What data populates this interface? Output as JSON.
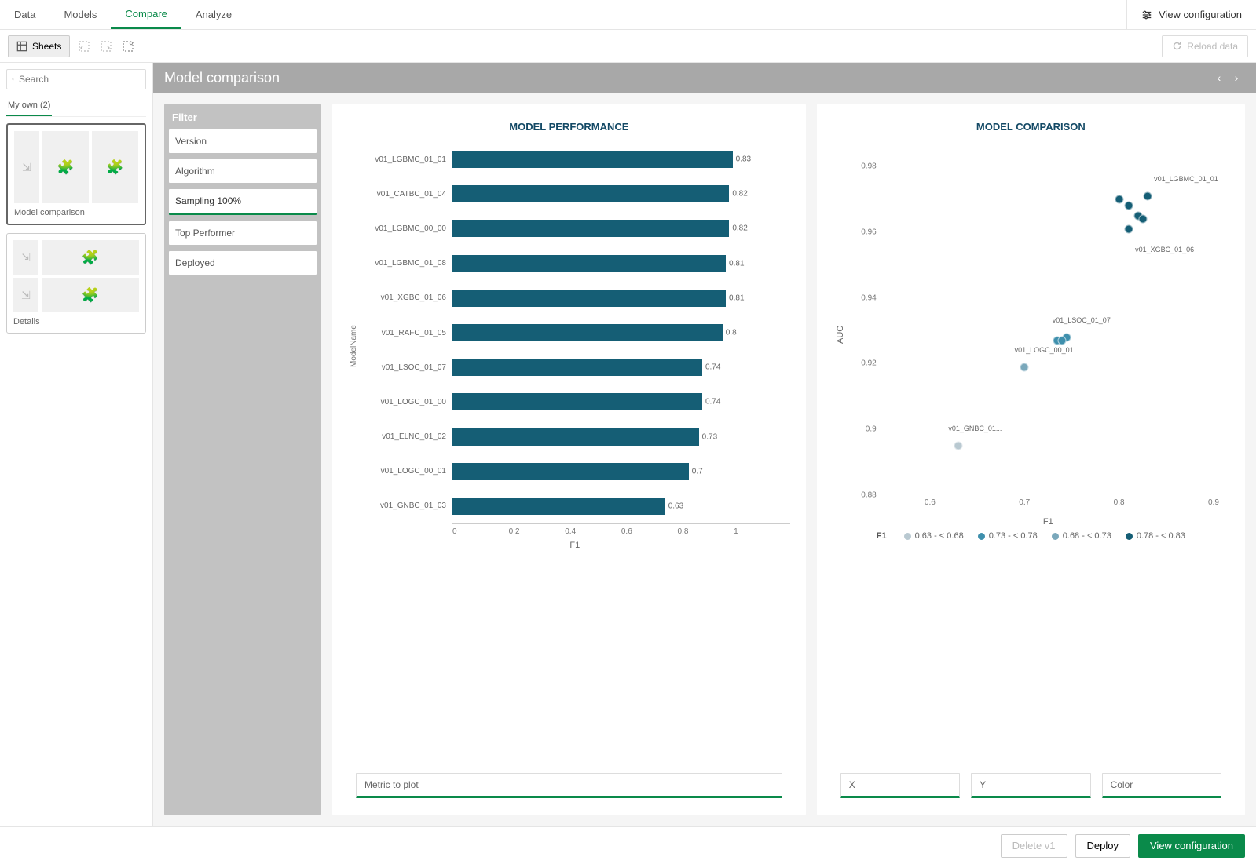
{
  "nav": {
    "tabs": [
      "Data",
      "Models",
      "Compare",
      "Analyze"
    ],
    "activeIndex": 2,
    "viewConfig": "View configuration"
  },
  "toolbar": {
    "sheets": "Sheets",
    "reload": "Reload data"
  },
  "sidebar": {
    "searchPlaceholder": "Search",
    "tab": "My own (2)",
    "sheets": [
      {
        "label": "Model comparison",
        "layout": "row3"
      },
      {
        "label": "Details",
        "layout": "stack2"
      }
    ]
  },
  "page": {
    "title": "Model comparison"
  },
  "filter": {
    "header": "Filter",
    "items": [
      "Version",
      "Algorithm",
      "Sampling 100%",
      "Top Performer",
      "Deployed"
    ],
    "selectedIndex": 2
  },
  "perf": {
    "title": "MODEL PERFORMANCE",
    "ylabel": "ModelName",
    "xlabel": "F1",
    "footerBtn": "Metric to plot",
    "xticks": [
      "0",
      "0.2",
      "0.4",
      "0.6",
      "0.8",
      "1"
    ]
  },
  "comp": {
    "title": "MODEL COMPARISON",
    "ylabel": "AUC",
    "xlabel": "F1",
    "footerBtns": [
      "X",
      "Y",
      "Color"
    ],
    "legendTitle": "F1",
    "legendItems": [
      {
        "label": "0.63 - < 0.68",
        "color": "#b9c9d1"
      },
      {
        "label": "0.73 - < 0.78",
        "color": "#3f90ad"
      },
      {
        "label": "0.68 - < 0.73",
        "color": "#7aa8bb"
      },
      {
        "label": "0.78 - < 0.83",
        "color": "#155e75"
      }
    ],
    "yticks": [
      {
        "v": 0.98,
        "label": "0.98"
      },
      {
        "v": 0.96,
        "label": "0.96"
      },
      {
        "v": 0.94,
        "label": "0.94"
      },
      {
        "v": 0.92,
        "label": "0.92"
      },
      {
        "v": 0.9,
        "label": "0.9"
      },
      {
        "v": 0.88,
        "label": "0.88"
      }
    ],
    "xticks": [
      {
        "v": 0.6,
        "label": "0.6"
      },
      {
        "v": 0.7,
        "label": "0.7"
      },
      {
        "v": 0.8,
        "label": "0.8"
      },
      {
        "v": 0.9,
        "label": "0.9"
      }
    ]
  },
  "footer": {
    "delete": "Delete v1",
    "deploy": "Deploy",
    "viewConfig": "View configuration"
  },
  "chart_data": [
    {
      "type": "bar",
      "title": "MODEL PERFORMANCE",
      "xlabel": "F1",
      "ylabel": "ModelName",
      "xlim": [
        0,
        1
      ],
      "categories": [
        "v01_LGBMC_01_01",
        "v01_CATBC_01_04",
        "v01_LGBMC_00_00",
        "v01_LGBMC_01_08",
        "v01_XGBC_01_06",
        "v01_RAFC_01_05",
        "v01_LSOC_01_07",
        "v01_LOGC_01_00",
        "v01_ELNC_01_02",
        "v01_LOGC_00_01",
        "v01_GNBC_01_03"
      ],
      "values": [
        0.83,
        0.82,
        0.82,
        0.81,
        0.81,
        0.8,
        0.74,
        0.74,
        0.73,
        0.7,
        0.63
      ]
    },
    {
      "type": "scatter",
      "title": "MODEL COMPARISON",
      "xlabel": "F1",
      "ylabel": "AUC",
      "xlim": [
        0.55,
        0.9
      ],
      "ylim": [
        0.88,
        0.985
      ],
      "annotations": [
        {
          "x": 0.83,
          "y": 0.971,
          "text": "v01_LGBMC_01_01"
        },
        {
          "x": 0.81,
          "y": 0.961,
          "text": "v01_XGBC_01_06"
        },
        {
          "x": 0.74,
          "y": 0.928,
          "text": "v01_LSOC_01_07"
        },
        {
          "x": 0.7,
          "y": 0.919,
          "text": "v01_LOGC_00_01"
        },
        {
          "x": 0.63,
          "y": 0.895,
          "text": "v01_GNBC_01..."
        }
      ],
      "series": [
        {
          "name": "0.63 - < 0.68",
          "color": "#b9c9d1",
          "points": [
            {
              "x": 0.63,
              "y": 0.895
            }
          ]
        },
        {
          "name": "0.68 - < 0.73",
          "color": "#7aa8bb",
          "points": [
            {
              "x": 0.7,
              "y": 0.919
            }
          ]
        },
        {
          "name": "0.73 - < 0.78",
          "color": "#3f90ad",
          "points": [
            {
              "x": 0.735,
              "y": 0.927
            },
            {
              "x": 0.745,
              "y": 0.928
            },
            {
              "x": 0.74,
              "y": 0.927
            }
          ]
        },
        {
          "name": "0.78 - < 0.83",
          "color": "#155e75",
          "points": [
            {
              "x": 0.8,
              "y": 0.97
            },
            {
              "x": 0.81,
              "y": 0.961
            },
            {
              "x": 0.81,
              "y": 0.968
            },
            {
              "x": 0.82,
              "y": 0.965
            },
            {
              "x": 0.825,
              "y": 0.964
            },
            {
              "x": 0.83,
              "y": 0.971
            }
          ]
        }
      ]
    }
  ]
}
